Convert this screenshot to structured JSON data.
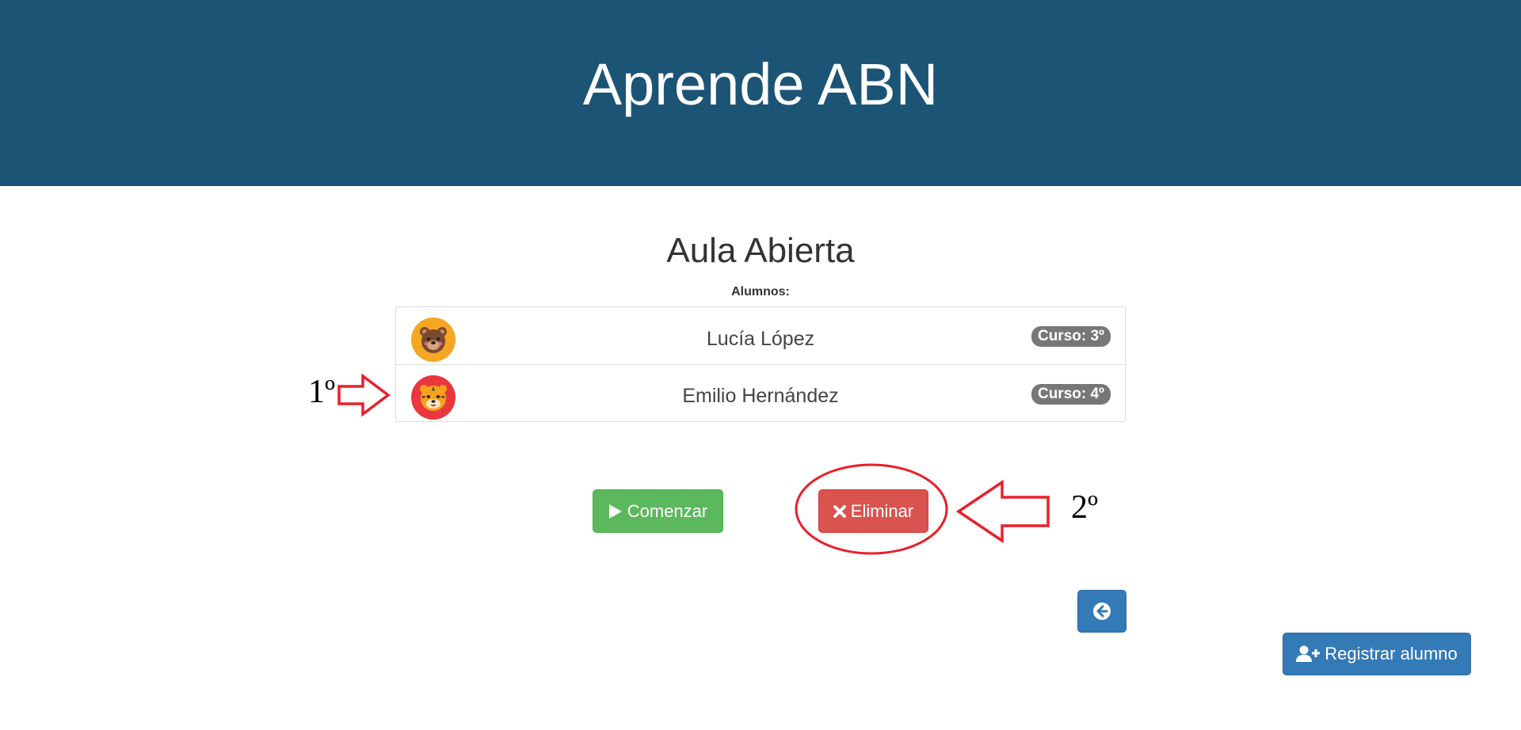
{
  "header": {
    "title": "Aprende ABN"
  },
  "classroom": {
    "title": "Aula Abierta",
    "students_label": "Alumnos:",
    "students": [
      {
        "name": "Lucía López",
        "course": "Curso: 3º",
        "avatar": "bear-icon",
        "avatar_color": "#f5a623"
      },
      {
        "name": "Emilio Hernández",
        "course": "Curso: 4º",
        "avatar": "tiger-icon",
        "avatar_color": "#e8383d"
      }
    ]
  },
  "actions": {
    "start_label": "Comenzar",
    "start_icon": "play-icon",
    "delete_label": "Eliminar",
    "delete_icon": "times-icon",
    "back_icon": "arrow-circle-left-icon",
    "register_label": "Registrar alumno",
    "register_icon": "user-plus-icon"
  },
  "annotations": {
    "step1": "1º",
    "step2": "2º",
    "color": "#e8202a"
  },
  "colors": {
    "header_bg": "#1c5476",
    "start_button": "#5cb85c",
    "delete_button": "#d9534f",
    "primary_button": "#337ab7",
    "badge": "#777777"
  }
}
